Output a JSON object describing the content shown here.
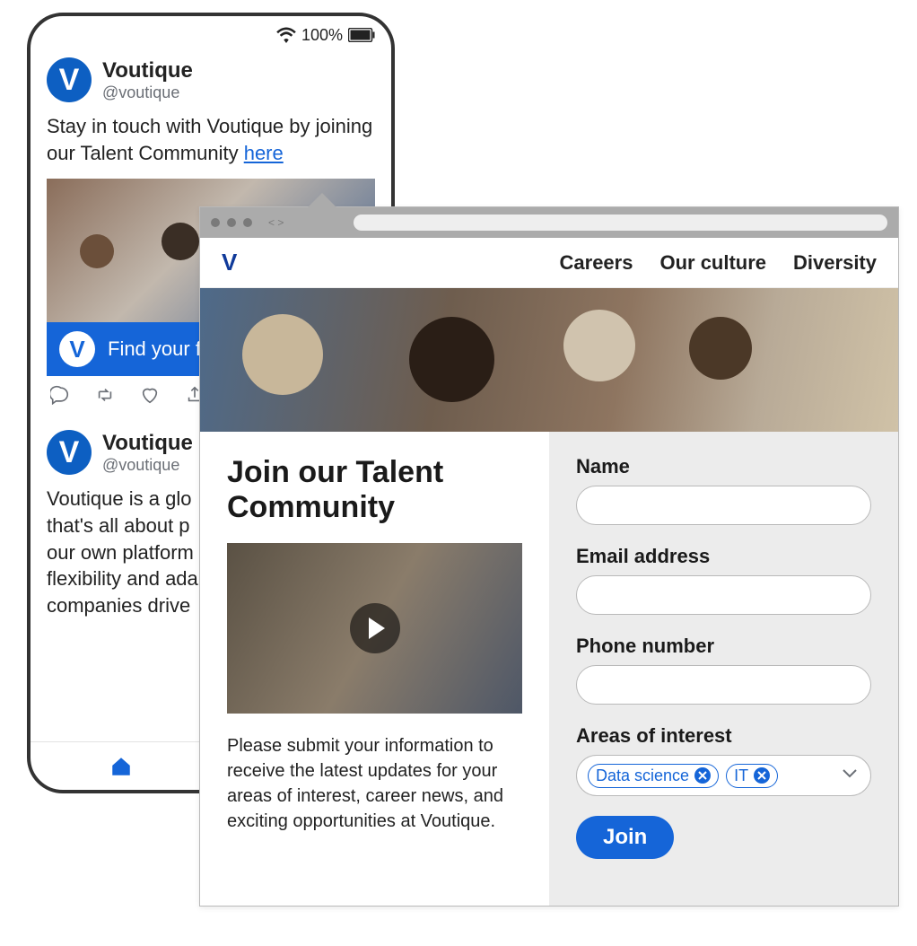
{
  "phone": {
    "status": {
      "battery_percent": "100%"
    },
    "posts": [
      {
        "author_name": "Voutique",
        "author_handle": "@voutique",
        "text_prefix": "Stay in touch with Voutique by joining our Talent Community ",
        "link_text": "here",
        "banner_text": "Find your fi"
      },
      {
        "author_name": "Voutique",
        "author_handle": "@voutique",
        "text": "Voutique is a glo\nthat's all about p\nour own platform\nflexibility and ada\ncompanies drive"
      }
    ]
  },
  "browser": {
    "nav": {
      "careers": "Careers",
      "culture": "Our culture",
      "diversity": "Diversity"
    },
    "left": {
      "heading": "Join our Talent Community",
      "body": "Please submit your information to receive the latest updates for your areas of interest, career news, and exciting opportunities at Voutique."
    },
    "form": {
      "name_label": "Name",
      "email_label": "Email address",
      "phone_label": "Phone number",
      "areas_label": "Areas of interest",
      "chips": [
        "Data science",
        "IT"
      ],
      "join_label": "Join"
    }
  }
}
